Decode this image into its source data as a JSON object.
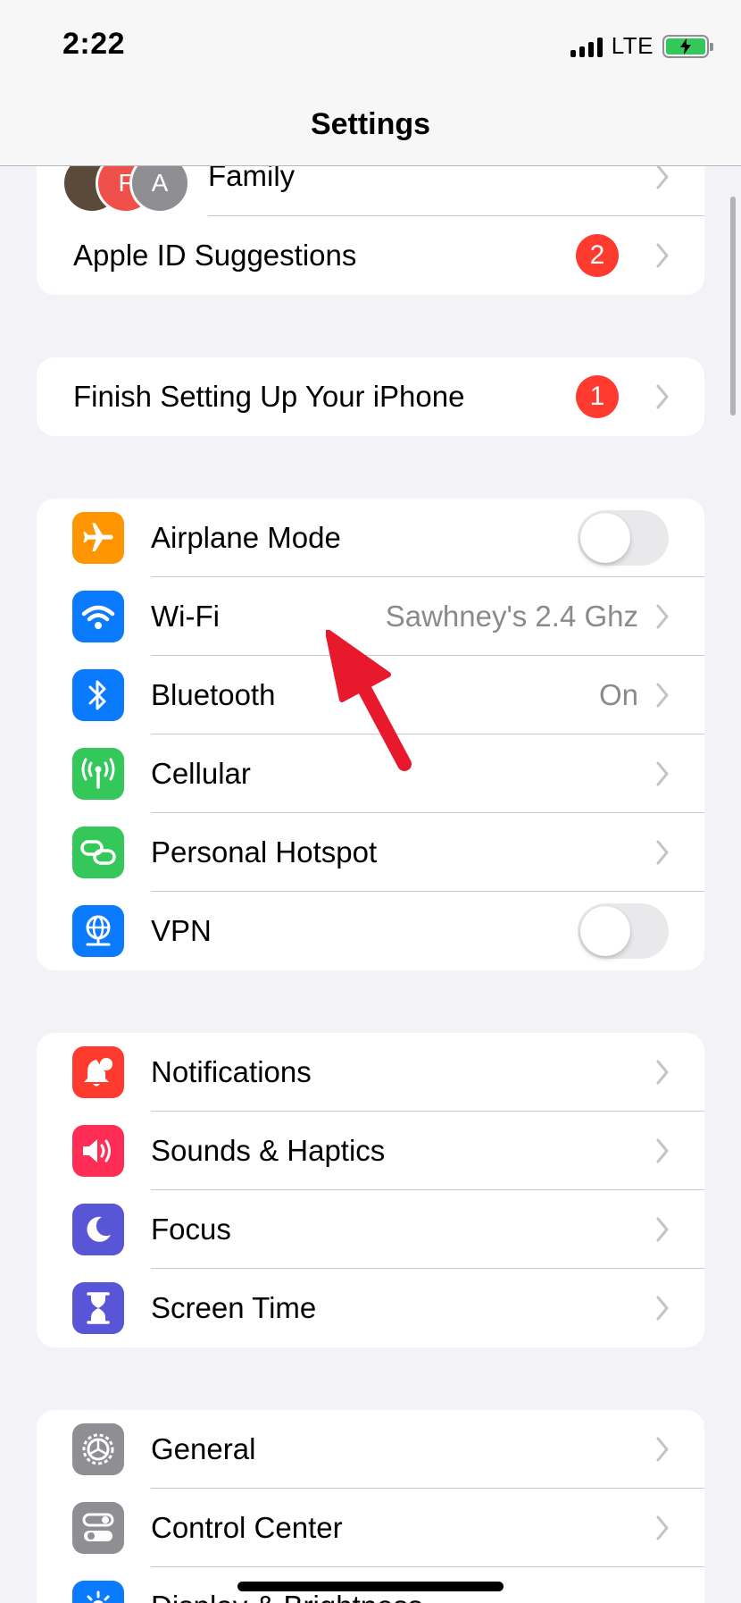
{
  "status_bar": {
    "time": "2:22",
    "network": "LTE"
  },
  "nav": {
    "title": "Settings"
  },
  "account": {
    "avatars": [
      "F",
      "A"
    ],
    "family_label": "Family",
    "suggestions_label": "Apple ID Suggestions",
    "suggestions_badge": "2"
  },
  "setup": {
    "label": "Finish Setting Up Your iPhone",
    "badge": "1"
  },
  "connectivity": {
    "airplane": {
      "label": "Airplane Mode",
      "on": false
    },
    "wifi": {
      "label": "Wi-Fi",
      "value": "Sawhney's 2.4 Ghz"
    },
    "bluetooth": {
      "label": "Bluetooth",
      "value": "On"
    },
    "cellular": {
      "label": "Cellular"
    },
    "hotspot": {
      "label": "Personal Hotspot"
    },
    "vpn": {
      "label": "VPN",
      "on": false
    }
  },
  "attention": {
    "notifications": "Notifications",
    "sounds": "Sounds & Haptics",
    "focus": "Focus",
    "screen_time": "Screen Time"
  },
  "system": {
    "general": "General",
    "control_center": "Control Center",
    "display": "Display & Brightness"
  },
  "colors": {
    "airplane": "#ff9500",
    "wifi": "#0a7aff",
    "bluetooth": "#0a7aff",
    "cellular": "#34c759",
    "hotspot": "#34c759",
    "vpn": "#0a7aff",
    "notifications": "#ff3b30",
    "sounds": "#ff2d55",
    "focus": "#5856d6",
    "screen_time": "#5856d6",
    "general": "#8e8e93",
    "control_center": "#8e8e93",
    "badge": "#ff3b30",
    "annotation_arrow": "#e8192c"
  }
}
